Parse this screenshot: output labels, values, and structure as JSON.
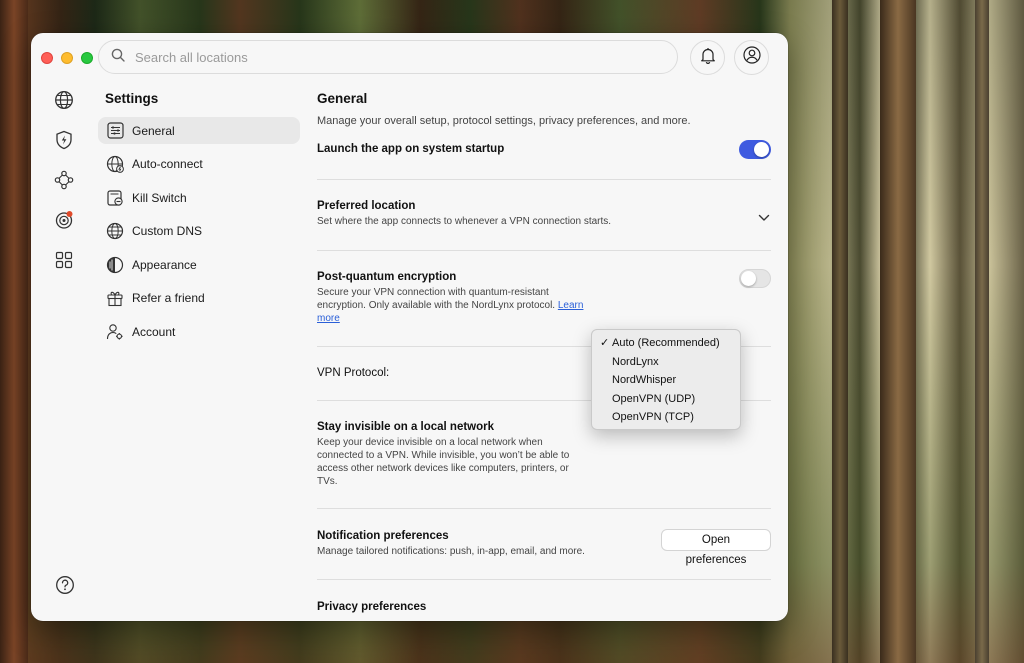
{
  "search": {
    "placeholder": "Search all locations"
  },
  "sidebar": {
    "title": "Settings",
    "items": [
      {
        "label": "General",
        "icon": "sliders-icon"
      },
      {
        "label": "Auto-connect",
        "icon": "globe-lightning-icon"
      },
      {
        "label": "Kill Switch",
        "icon": "kill-switch-icon"
      },
      {
        "label": "Custom DNS",
        "icon": "dns-globe-icon"
      },
      {
        "label": "Appearance",
        "icon": "appearance-icon"
      },
      {
        "label": "Refer a friend",
        "icon": "gift-icon"
      },
      {
        "label": "Account",
        "icon": "account-gear-icon"
      }
    ]
  },
  "main": {
    "title": "General",
    "subtitle": "Manage your overall setup, protocol settings, privacy preferences, and more.",
    "launch": {
      "title": "Launch the app on system startup",
      "enabled": true
    },
    "preferred": {
      "title": "Preferred location",
      "desc": "Set where the app connects to whenever a VPN connection starts."
    },
    "pq": {
      "title": "Post-quantum encryption",
      "desc_line1": "Secure your VPN connection with quantum-resistant",
      "desc_line2": "encryption. Only available with the NordLynx protocol.",
      "learn1": "Learn",
      "learn2": "more",
      "enabled": false
    },
    "protocol": {
      "label": "VPN Protocol:"
    },
    "invisible": {
      "title": "Stay invisible on a local network",
      "desc_line1": "Keep your device invisible on a local network when",
      "desc_line2": "connected to a VPN. While invisible, you won’t be able to",
      "desc_line3": "access other network devices like computers, printers, or",
      "desc_line4": "TVs."
    },
    "notifications": {
      "title": "Notification preferences",
      "desc": "Manage tailored notifications: push, in-app, email, and more.",
      "button": "Open preferences"
    },
    "privacy": {
      "title": "Privacy preferences"
    }
  },
  "dropdown": {
    "options": [
      "Auto (Recommended)",
      "NordLynx",
      "NordWhisper",
      "OpenVPN (UDP)",
      "OpenVPN (TCP)"
    ],
    "selected": "Auto (Recommended)",
    "check": "✓"
  },
  "colors": {
    "accent": "#3f5be0",
    "link": "#2a5fd8",
    "notification_dot": "#e04a2a"
  }
}
